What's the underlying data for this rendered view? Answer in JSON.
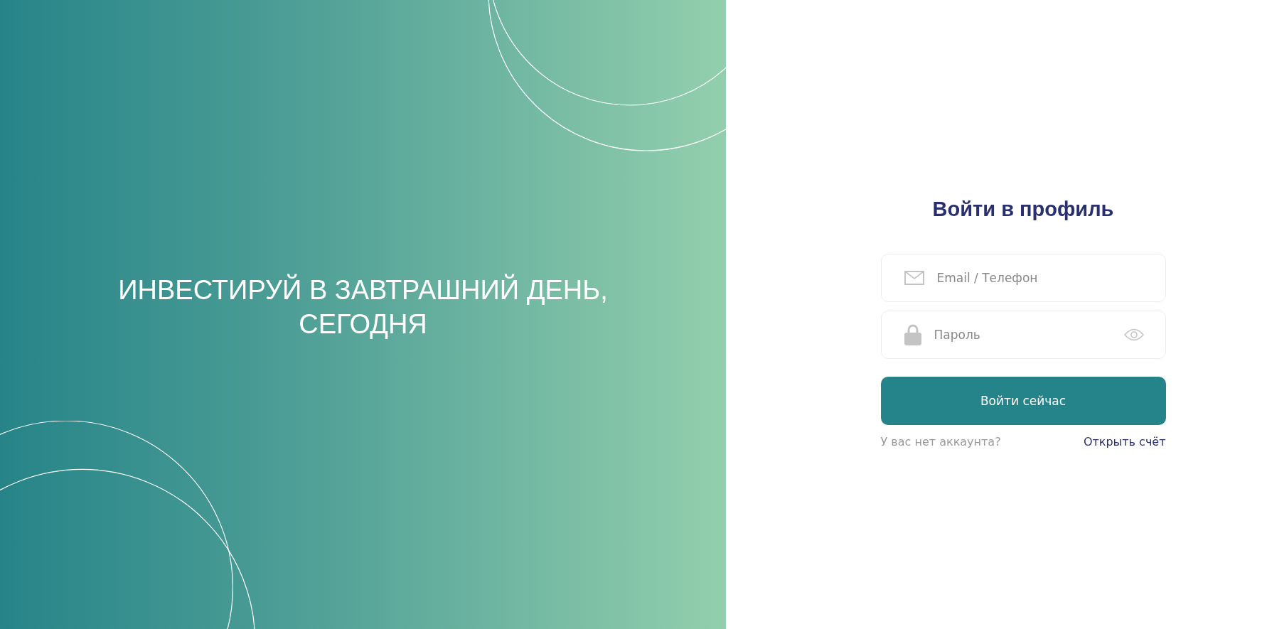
{
  "hero": {
    "headline": "ИНВЕСТИРУЙ В ЗАВТРАШНИЙ ДЕНЬ, СЕГОДНЯ"
  },
  "login": {
    "title": "Войти в профиль",
    "fields": [
      {
        "kind": "email",
        "placeholder": "Email / Телефон"
      },
      {
        "kind": "password",
        "placeholder": "Пароль"
      }
    ],
    "submit": "Войти сейчас",
    "prompt": "У вас нет аккаунта?",
    "link": "Открыть счёт"
  }
}
